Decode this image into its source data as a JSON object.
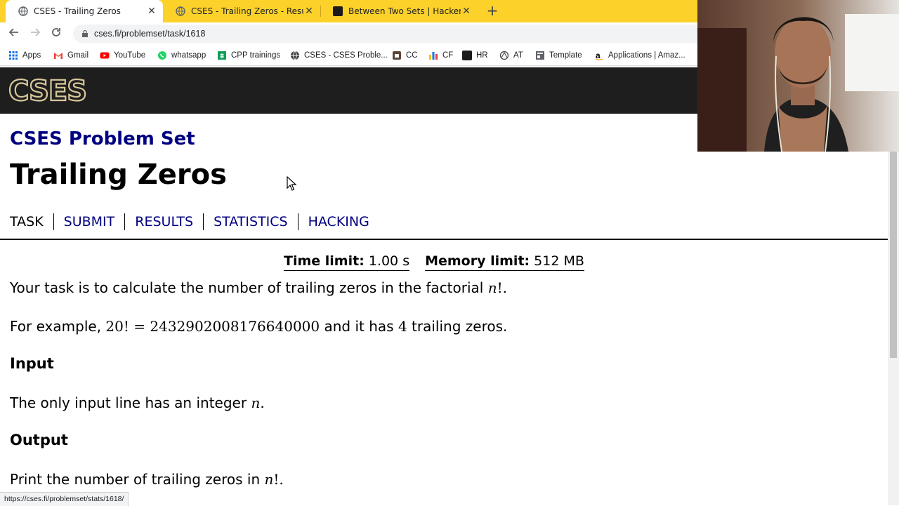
{
  "browser": {
    "tabs": [
      {
        "title": "CSES - Trailing Zeros",
        "active": true
      },
      {
        "title": "CSES - Trailing Zeros - Results",
        "active": false
      },
      {
        "title": "Between Two Sets | HackerRank",
        "active": false
      }
    ],
    "new_tab_glyph": "+",
    "close_glyph": "✕",
    "url": "cses.fi/problemset/task/1618",
    "bookmarks": [
      "Apps",
      "Gmail",
      "YouTube",
      "whatsapp",
      "CPP trainings",
      "CSES - CSES Proble...",
      "CC",
      "CF",
      "HR",
      "AT",
      "Template",
      "Applications | Amaz..."
    ],
    "status_url": "https://cses.fi/problemset/stats/1618/",
    "colors": {
      "tabstrip": "#fcd12a",
      "header": "#1e1e1e",
      "link": "#000080"
    }
  },
  "site": {
    "logo": "CSES",
    "problem_set": "CSES Problem Set",
    "task_title": "Trailing Zeros",
    "nav": [
      "TASK",
      "SUBMIT",
      "RESULTS",
      "STATISTICS",
      "HACKING"
    ],
    "time_limit_label": "Time limit:",
    "time_limit_value": "1.00 s",
    "memory_limit_label": "Memory limit:",
    "memory_limit_value": "512 MB"
  },
  "statement": {
    "p1_text": "Your task is to calculate the number of trailing zeros in the factorial ",
    "p1_math": "n",
    "p1_end": "!.",
    "p2_text": "For example, ",
    "p2_math": "20! = 2432902008176640000",
    "p2_mid": " and it has ",
    "p2_num": "4",
    "p2_end": " trailing zeros.",
    "input_heading": "Input",
    "input_text": "The only input line has an integer ",
    "input_math": "n",
    "input_end": ".",
    "output_heading": "Output",
    "output_text": "Print the number of trailing zeros in ",
    "output_math": "n",
    "output_end": "!."
  }
}
